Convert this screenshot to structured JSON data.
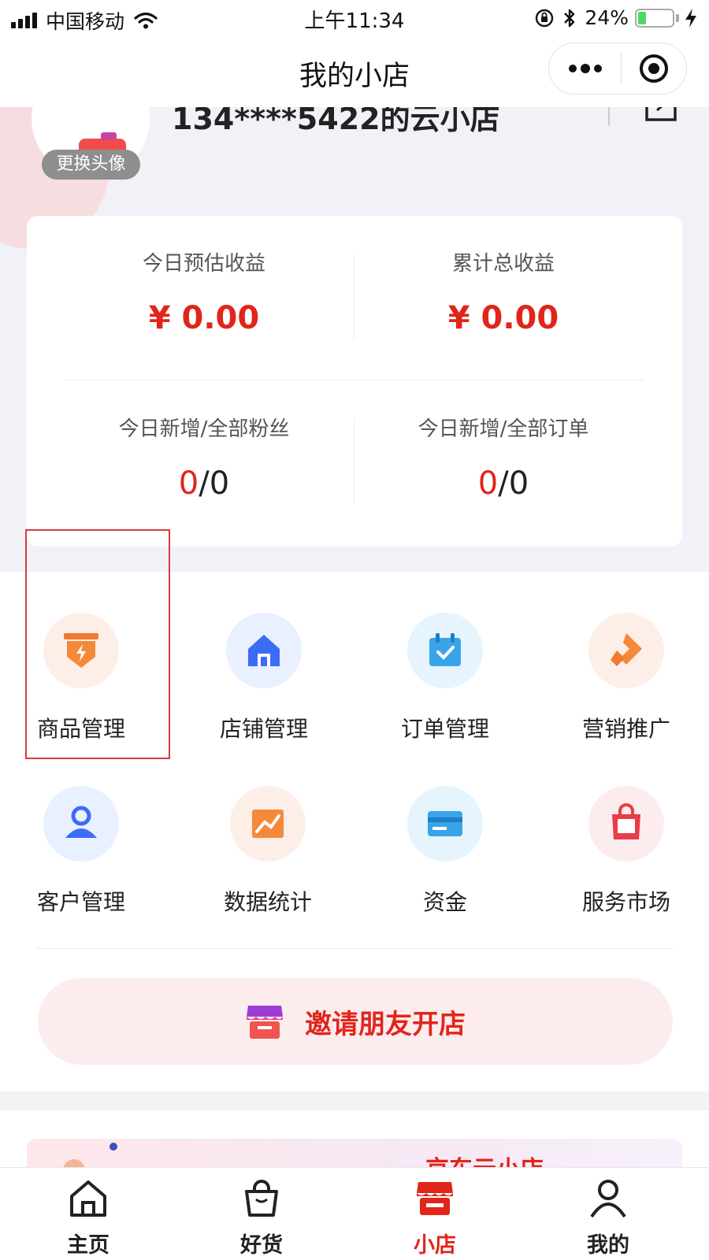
{
  "status_bar": {
    "carrier": "中国移动",
    "time": "上午11:34",
    "battery": "24%",
    "battery_level": 0.24
  },
  "nav": {
    "title": "我的小店"
  },
  "header": {
    "shop_name": "134****5422的云小店",
    "change_avatar": "更换头像"
  },
  "stats": {
    "today_income_label": "今日预估收益",
    "today_income_value": "¥ 0.00",
    "total_income_label": "累计总收益",
    "total_income_value": "¥ 0.00",
    "fans_label": "今日新增/全部粉丝",
    "fans_new": "0",
    "fans_total": "/0",
    "orders_label": "今日新增/全部订单",
    "orders_new": "0",
    "orders_total": "/0"
  },
  "menu": {
    "items": [
      {
        "label": "商品管理",
        "icon": "goods-icon"
      },
      {
        "label": "店铺管理",
        "icon": "store-icon"
      },
      {
        "label": "订单管理",
        "icon": "order-icon"
      },
      {
        "label": "营销推广",
        "icon": "marketing-icon"
      },
      {
        "label": "客户管理",
        "icon": "customer-icon"
      },
      {
        "label": "数据统计",
        "icon": "data-icon"
      },
      {
        "label": "资金",
        "icon": "funds-icon"
      },
      {
        "label": "服务市场",
        "icon": "market-icon"
      }
    ]
  },
  "invite": {
    "label": "邀请朋友开店"
  },
  "banner": {
    "title": "京东云小店"
  },
  "tabs": [
    {
      "label": "主页",
      "icon": "home-icon"
    },
    {
      "label": "好货",
      "icon": "bag-icon"
    },
    {
      "label": "小店",
      "icon": "shop-icon",
      "active": true
    },
    {
      "label": "我的",
      "icon": "person-icon"
    }
  ],
  "colors": {
    "accent": "#e1251b",
    "text": "#222222"
  }
}
